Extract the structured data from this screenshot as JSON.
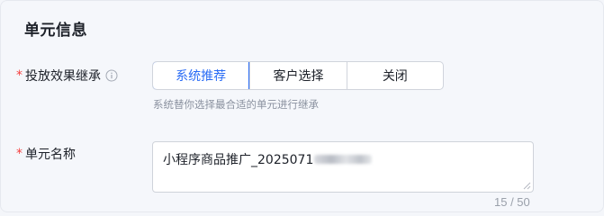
{
  "section": {
    "title": "单元信息"
  },
  "delivery_inherit": {
    "required_mark": "*",
    "label": "投放效果继承",
    "info_icon": "info-icon",
    "options": [
      "系统推荐",
      "客户选择",
      "关闭"
    ],
    "selected": "系统推荐",
    "hint": "系统替你选择最合适的单元进行继承"
  },
  "unit_name": {
    "required_mark": "*",
    "label": "单元名称",
    "value": "小程序商品推广_2025071",
    "counter": "15 / 50"
  },
  "colors": {
    "accent": "#2a6cf5",
    "required": "#f53f3f",
    "text": "#1d2129",
    "hint": "#8a919f"
  }
}
